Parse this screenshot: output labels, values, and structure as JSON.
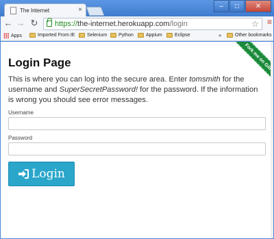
{
  "browser": {
    "tab_title": "The Internet",
    "tab_close": "×",
    "controls": {
      "minimize": "–",
      "maximize": "□",
      "close": "✕"
    },
    "url_scheme": "https://",
    "url_host": "the-internet.herokuapp.com",
    "url_path": "/login",
    "bookmarks": [
      "Apps",
      "Imported From IE",
      "Selenium",
      "Python",
      "Appium",
      "Eclipse"
    ],
    "bookmarks_overflow": "»",
    "other_bookmarks": "Other bookmarks"
  },
  "ribbon": {
    "label": "Fork me on GitHub"
  },
  "page": {
    "heading": "Login Page",
    "intro_1": "This is where you can log into the secure area. Enter ",
    "intro_user": "tomsmith",
    "intro_2": " for the username and ",
    "intro_pass": "SuperSecretPassword!",
    "intro_3": " for the password. If the information is wrong you should see error messages."
  },
  "form": {
    "username_label": "Username",
    "username_value": "",
    "password_label": "Password",
    "password_value": "",
    "login_label": "Login"
  }
}
